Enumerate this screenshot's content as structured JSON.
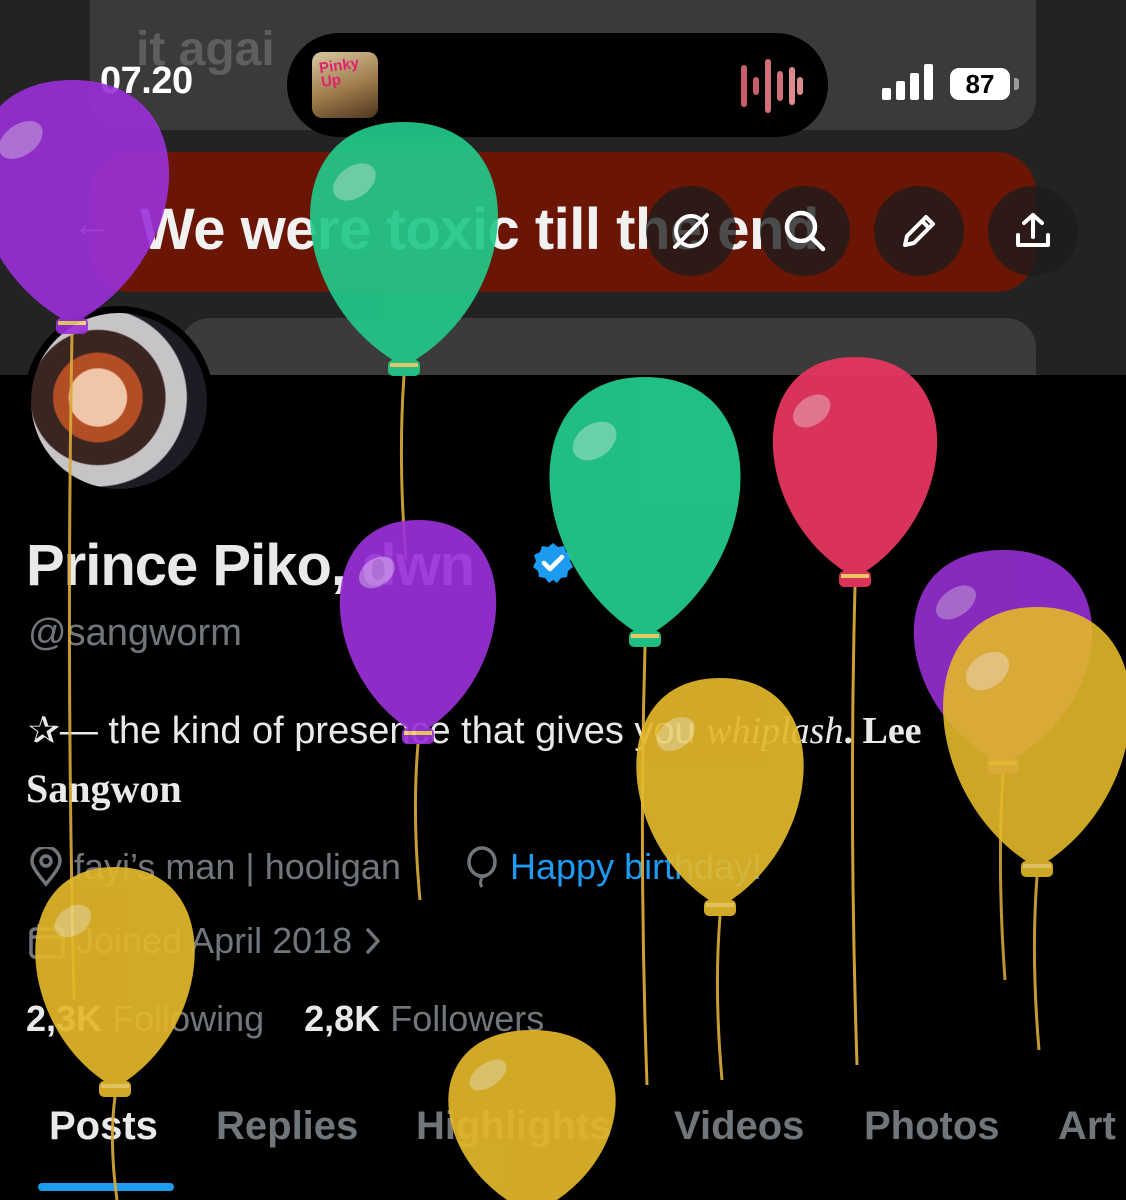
{
  "status_bar": {
    "time": "07.20",
    "battery": "87",
    "album_text": "Pinky Up"
  },
  "banner": {
    "faded_top": "it agai",
    "title": "We were toxic till the end"
  },
  "profile": {
    "display_name": "Prince Piko, dwn",
    "handle": "@sangworm",
    "bio_line1_prefix": "✰— the kind of presence that gives you ",
    "bio_line1_italic": "whiplash",
    "bio_line1_suffix": ". Lee",
    "bio_line2": "Sangwon",
    "location": "fayi’s man | hooligan",
    "birthday": "Happy birthday!",
    "joined": "Joined April 2018",
    "following_count": "2,3K",
    "following_label": "Following",
    "followers_count": "2,8K",
    "followers_label": "Followers"
  },
  "tabs": [
    "Posts",
    "Replies",
    "Highlights",
    "Videos",
    "Photos",
    "Art"
  ],
  "active_tab": "Posts",
  "icons": [
    "back-arrow-icon",
    "grok-icon",
    "search-icon",
    "edit-pencil-icon",
    "share-upload-icon",
    "verified-badge-icon",
    "location-pin-icon",
    "balloon-icon",
    "calendar-icon",
    "chevron-right-icon",
    "signal-icon",
    "audio-wave-icon"
  ],
  "colors": {
    "accent_blue": "#1d9bf0",
    "banner_red": "#6b1605",
    "balloon_purple": "#9b30d9",
    "balloon_green": "#22c98a",
    "balloon_red": "#e5365e",
    "balloon_yellow": "#e3b82a"
  }
}
